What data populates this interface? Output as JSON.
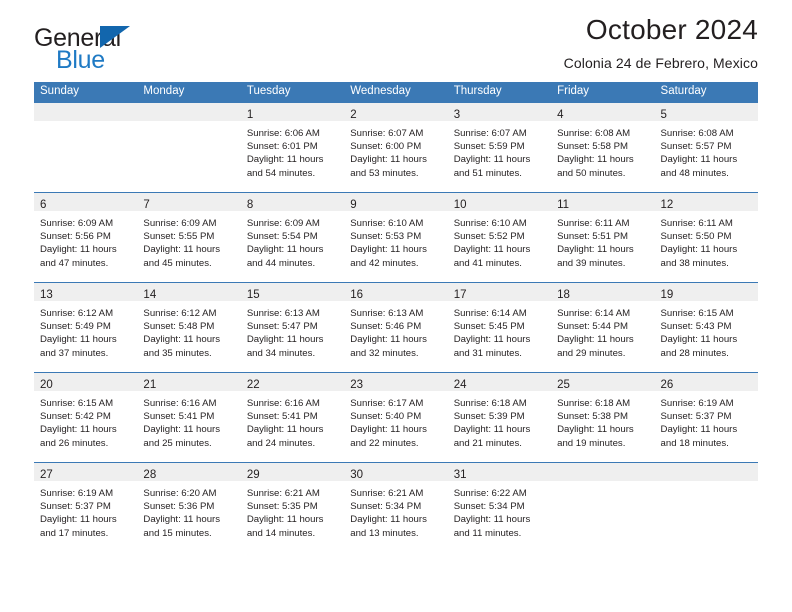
{
  "brand": {
    "word_one": "General",
    "word_two": "Blue",
    "flag_icon": "triangle-flag-icon"
  },
  "header": {
    "title": "October 2024",
    "subtitle": "Colonia 24 de Febrero, Mexico"
  },
  "calendar": {
    "weekday_headers": [
      "Sunday",
      "Monday",
      "Tuesday",
      "Wednesday",
      "Thursday",
      "Friday",
      "Saturday"
    ],
    "labels": {
      "sunrise": "Sunrise:",
      "sunset": "Sunset:",
      "daylight": "Daylight:"
    },
    "colors": {
      "header_blue": "#3b79b5",
      "daynum_band": "#efefef",
      "brand_blue": "#1f7ac4",
      "flag_blue": "#1266ad"
    },
    "weeks": [
      [
        {
          "day": "",
          "sunrise": "",
          "sunset": "",
          "daylight_line1": "",
          "daylight_line2": ""
        },
        {
          "day": "",
          "sunrise": "",
          "sunset": "",
          "daylight_line1": "",
          "daylight_line2": ""
        },
        {
          "day": "1",
          "sunrise": "Sunrise: 6:06 AM",
          "sunset": "Sunset: 6:01 PM",
          "daylight_line1": "Daylight: 11 hours",
          "daylight_line2": "and 54 minutes."
        },
        {
          "day": "2",
          "sunrise": "Sunrise: 6:07 AM",
          "sunset": "Sunset: 6:00 PM",
          "daylight_line1": "Daylight: 11 hours",
          "daylight_line2": "and 53 minutes."
        },
        {
          "day": "3",
          "sunrise": "Sunrise: 6:07 AM",
          "sunset": "Sunset: 5:59 PM",
          "daylight_line1": "Daylight: 11 hours",
          "daylight_line2": "and 51 minutes."
        },
        {
          "day": "4",
          "sunrise": "Sunrise: 6:08 AM",
          "sunset": "Sunset: 5:58 PM",
          "daylight_line1": "Daylight: 11 hours",
          "daylight_line2": "and 50 minutes."
        },
        {
          "day": "5",
          "sunrise": "Sunrise: 6:08 AM",
          "sunset": "Sunset: 5:57 PM",
          "daylight_line1": "Daylight: 11 hours",
          "daylight_line2": "and 48 minutes."
        }
      ],
      [
        {
          "day": "6",
          "sunrise": "Sunrise: 6:09 AM",
          "sunset": "Sunset: 5:56 PM",
          "daylight_line1": "Daylight: 11 hours",
          "daylight_line2": "and 47 minutes."
        },
        {
          "day": "7",
          "sunrise": "Sunrise: 6:09 AM",
          "sunset": "Sunset: 5:55 PM",
          "daylight_line1": "Daylight: 11 hours",
          "daylight_line2": "and 45 minutes."
        },
        {
          "day": "8",
          "sunrise": "Sunrise: 6:09 AM",
          "sunset": "Sunset: 5:54 PM",
          "daylight_line1": "Daylight: 11 hours",
          "daylight_line2": "and 44 minutes."
        },
        {
          "day": "9",
          "sunrise": "Sunrise: 6:10 AM",
          "sunset": "Sunset: 5:53 PM",
          "daylight_line1": "Daylight: 11 hours",
          "daylight_line2": "and 42 minutes."
        },
        {
          "day": "10",
          "sunrise": "Sunrise: 6:10 AM",
          "sunset": "Sunset: 5:52 PM",
          "daylight_line1": "Daylight: 11 hours",
          "daylight_line2": "and 41 minutes."
        },
        {
          "day": "11",
          "sunrise": "Sunrise: 6:11 AM",
          "sunset": "Sunset: 5:51 PM",
          "daylight_line1": "Daylight: 11 hours",
          "daylight_line2": "and 39 minutes."
        },
        {
          "day": "12",
          "sunrise": "Sunrise: 6:11 AM",
          "sunset": "Sunset: 5:50 PM",
          "daylight_line1": "Daylight: 11 hours",
          "daylight_line2": "and 38 minutes."
        }
      ],
      [
        {
          "day": "13",
          "sunrise": "Sunrise: 6:12 AM",
          "sunset": "Sunset: 5:49 PM",
          "daylight_line1": "Daylight: 11 hours",
          "daylight_line2": "and 37 minutes."
        },
        {
          "day": "14",
          "sunrise": "Sunrise: 6:12 AM",
          "sunset": "Sunset: 5:48 PM",
          "daylight_line1": "Daylight: 11 hours",
          "daylight_line2": "and 35 minutes."
        },
        {
          "day": "15",
          "sunrise": "Sunrise: 6:13 AM",
          "sunset": "Sunset: 5:47 PM",
          "daylight_line1": "Daylight: 11 hours",
          "daylight_line2": "and 34 minutes."
        },
        {
          "day": "16",
          "sunrise": "Sunrise: 6:13 AM",
          "sunset": "Sunset: 5:46 PM",
          "daylight_line1": "Daylight: 11 hours",
          "daylight_line2": "and 32 minutes."
        },
        {
          "day": "17",
          "sunrise": "Sunrise: 6:14 AM",
          "sunset": "Sunset: 5:45 PM",
          "daylight_line1": "Daylight: 11 hours",
          "daylight_line2": "and 31 minutes."
        },
        {
          "day": "18",
          "sunrise": "Sunrise: 6:14 AM",
          "sunset": "Sunset: 5:44 PM",
          "daylight_line1": "Daylight: 11 hours",
          "daylight_line2": "and 29 minutes."
        },
        {
          "day": "19",
          "sunrise": "Sunrise: 6:15 AM",
          "sunset": "Sunset: 5:43 PM",
          "daylight_line1": "Daylight: 11 hours",
          "daylight_line2": "and 28 minutes."
        }
      ],
      [
        {
          "day": "20",
          "sunrise": "Sunrise: 6:15 AM",
          "sunset": "Sunset: 5:42 PM",
          "daylight_line1": "Daylight: 11 hours",
          "daylight_line2": "and 26 minutes."
        },
        {
          "day": "21",
          "sunrise": "Sunrise: 6:16 AM",
          "sunset": "Sunset: 5:41 PM",
          "daylight_line1": "Daylight: 11 hours",
          "daylight_line2": "and 25 minutes."
        },
        {
          "day": "22",
          "sunrise": "Sunrise: 6:16 AM",
          "sunset": "Sunset: 5:41 PM",
          "daylight_line1": "Daylight: 11 hours",
          "daylight_line2": "and 24 minutes."
        },
        {
          "day": "23",
          "sunrise": "Sunrise: 6:17 AM",
          "sunset": "Sunset: 5:40 PM",
          "daylight_line1": "Daylight: 11 hours",
          "daylight_line2": "and 22 minutes."
        },
        {
          "day": "24",
          "sunrise": "Sunrise: 6:18 AM",
          "sunset": "Sunset: 5:39 PM",
          "daylight_line1": "Daylight: 11 hours",
          "daylight_line2": "and 21 minutes."
        },
        {
          "day": "25",
          "sunrise": "Sunrise: 6:18 AM",
          "sunset": "Sunset: 5:38 PM",
          "daylight_line1": "Daylight: 11 hours",
          "daylight_line2": "and 19 minutes."
        },
        {
          "day": "26",
          "sunrise": "Sunrise: 6:19 AM",
          "sunset": "Sunset: 5:37 PM",
          "daylight_line1": "Daylight: 11 hours",
          "daylight_line2": "and 18 minutes."
        }
      ],
      [
        {
          "day": "27",
          "sunrise": "Sunrise: 6:19 AM",
          "sunset": "Sunset: 5:37 PM",
          "daylight_line1": "Daylight: 11 hours",
          "daylight_line2": "and 17 minutes."
        },
        {
          "day": "28",
          "sunrise": "Sunrise: 6:20 AM",
          "sunset": "Sunset: 5:36 PM",
          "daylight_line1": "Daylight: 11 hours",
          "daylight_line2": "and 15 minutes."
        },
        {
          "day": "29",
          "sunrise": "Sunrise: 6:21 AM",
          "sunset": "Sunset: 5:35 PM",
          "daylight_line1": "Daylight: 11 hours",
          "daylight_line2": "and 14 minutes."
        },
        {
          "day": "30",
          "sunrise": "Sunrise: 6:21 AM",
          "sunset": "Sunset: 5:34 PM",
          "daylight_line1": "Daylight: 11 hours",
          "daylight_line2": "and 13 minutes."
        },
        {
          "day": "31",
          "sunrise": "Sunrise: 6:22 AM",
          "sunset": "Sunset: 5:34 PM",
          "daylight_line1": "Daylight: 11 hours",
          "daylight_line2": "and 11 minutes."
        },
        {
          "day": "",
          "sunrise": "",
          "sunset": "",
          "daylight_line1": "",
          "daylight_line2": ""
        },
        {
          "day": "",
          "sunrise": "",
          "sunset": "",
          "daylight_line1": "",
          "daylight_line2": ""
        }
      ]
    ]
  }
}
